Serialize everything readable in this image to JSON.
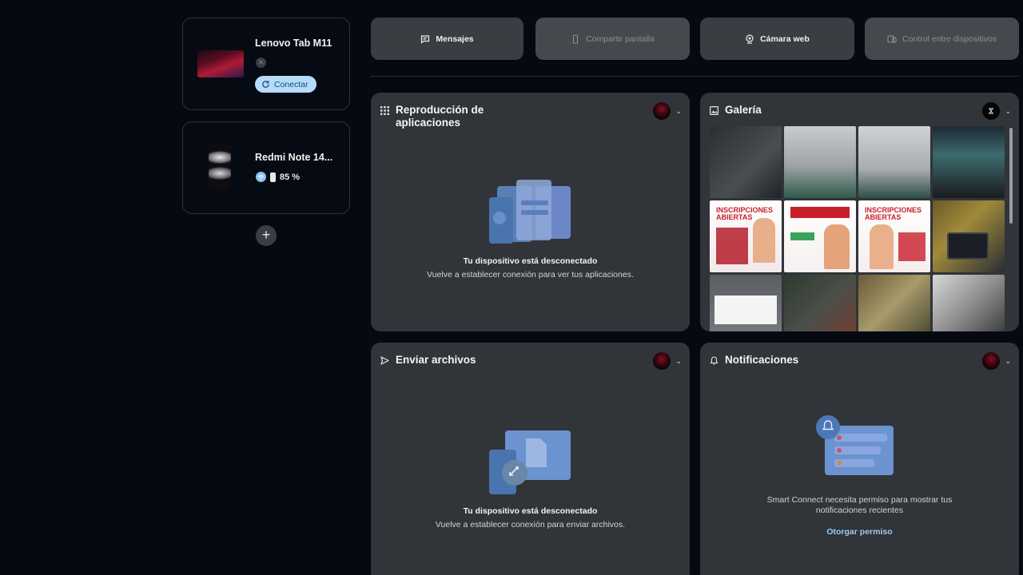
{
  "devices": [
    {
      "name": "Lenovo Tab M11",
      "action": "Conectar"
    },
    {
      "name": "Redmi Note 14...",
      "battery": "85 %"
    }
  ],
  "toolbar": {
    "messages": "Mensajes",
    "screen_share": "Compartir pantalla",
    "webcam": "Cámara web",
    "cross_control": "Control entre dispositivos"
  },
  "apps_panel": {
    "title_line1": "Reproducción de",
    "title_line2": "aplicaciones",
    "status": "Tu dispositivo está desconectado",
    "hint": "Vuelve a establecer conexión para ver tus aplicaciones."
  },
  "gallery_panel": {
    "title": "Galería",
    "poster_text": "INSCRIPCIONES ABIERTAS"
  },
  "files_panel": {
    "title": "Enviar archivos",
    "status": "Tu dispositivo está desconectado",
    "hint": "Vuelve a establecer conexión para enviar archivos."
  },
  "notifications_panel": {
    "title": "Notificaciones",
    "message_line1": "Smart Connect necesita permiso para mostrar tus",
    "message_line2": "notificaciones recientes",
    "action": "Otorgar permiso"
  },
  "colors": {
    "background": "#050a12",
    "panel": "#313438",
    "accent_link": "#9ccaf2",
    "connect_button": "#b5ddfb"
  }
}
